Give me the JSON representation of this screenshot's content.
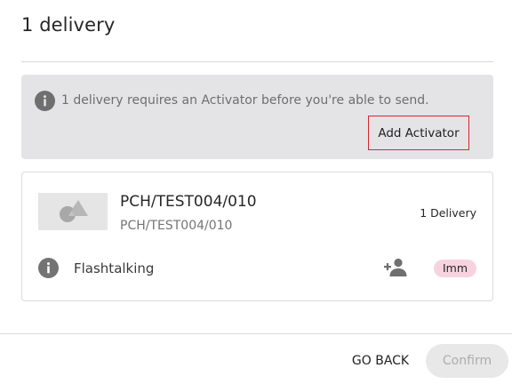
{
  "dialog": {
    "title": "1 delivery"
  },
  "notice": {
    "icon": "info-icon",
    "text": "1 delivery requires an Activator before you're able to send.",
    "add_button_label": "Add Activator",
    "background": "#e4e4e7",
    "highlight_color": "#d8262f"
  },
  "card": {
    "thumbnail_icon": "shapes-placeholder-icon",
    "name": "PCH/TEST004/010",
    "subtitle": "PCH/TEST004/010",
    "delivery_count": "1 Delivery",
    "row": {
      "icon": "info-icon",
      "vendor": "Flashtalking",
      "action_icon": "add-person-icon",
      "badge": "Imm",
      "badge_color": "#f7d3e0"
    }
  },
  "footer": {
    "back_label": "GO BACK",
    "confirm_label": "Confirm",
    "confirm_disabled": true
  }
}
